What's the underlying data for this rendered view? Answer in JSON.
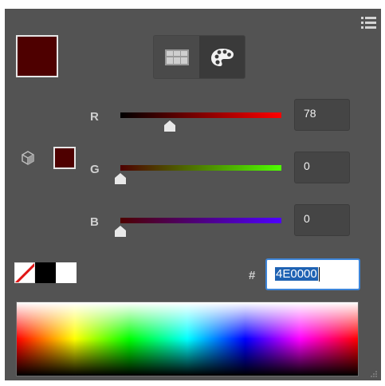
{
  "current_color": {
    "hex": "4E0000",
    "swatch": "#4e0000"
  },
  "channels": [
    {
      "key": "r",
      "label": "R",
      "value": "78",
      "fraction": 0.306,
      "track_from": "#000000",
      "track_to": "#ff0000"
    },
    {
      "key": "g",
      "label": "G",
      "value": "0",
      "fraction": 0.0,
      "track_from": "#4e0000",
      "track_to": "#4eff00"
    },
    {
      "key": "b",
      "label": "B",
      "value": "0",
      "fraction": 0.0,
      "track_from": "#4e0000",
      "track_to": "#4e00ff"
    }
  ],
  "hex_prefix": "#",
  "icons": {
    "menu": "hamburger-list-icon",
    "grid_mode": "grid-swatches-icon",
    "palette_mode": "palette-icon",
    "web_safe": "cube-icon",
    "none": "no-color-icon",
    "resize": "resize-grip-icon"
  },
  "quick_swatches": [
    "none",
    "#000000",
    "#ffffff"
  ],
  "colors": {
    "panel_bg": "#535353",
    "focus_blue": "#3d85d8",
    "selection_blue": "#1e62b3"
  }
}
